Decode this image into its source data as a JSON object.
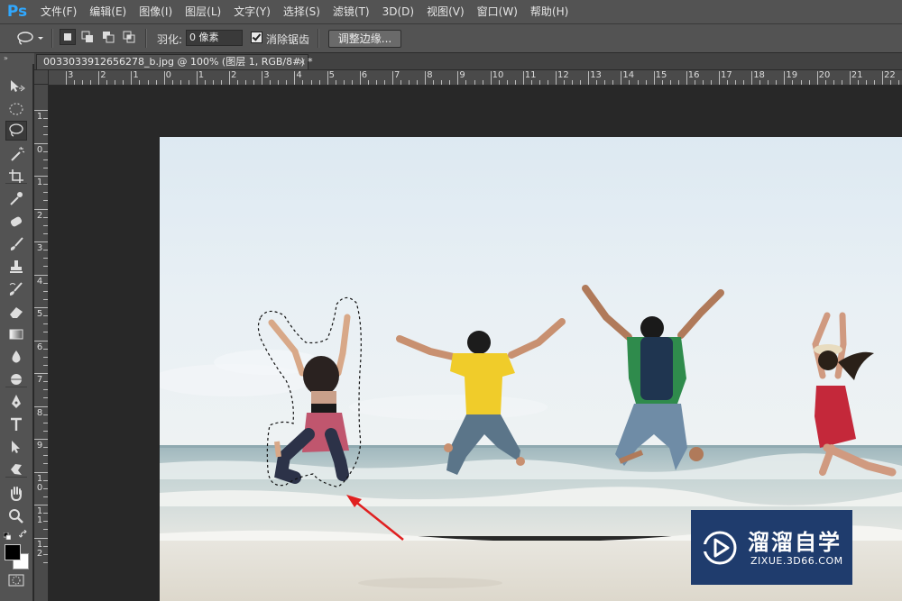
{
  "app": {
    "logo": "Ps"
  },
  "menu": [
    "文件(F)",
    "编辑(E)",
    "图像(I)",
    "图层(L)",
    "文字(Y)",
    "选择(S)",
    "滤镜(T)",
    "3D(D)",
    "视图(V)",
    "窗口(W)",
    "帮助(H)"
  ],
  "options": {
    "feather_label": "羽化:",
    "feather_value": "0 像素",
    "anti_alias_label": "消除锯齿",
    "anti_alias_checked": true,
    "refine_edge_label": "调整边缘..."
  },
  "panel_toggle": "»",
  "document": {
    "tab_title": "0033033912656278_b.jpg @ 100% (图层 1, RGB/8#) *",
    "close_glyph": "×"
  },
  "rulers": {
    "top_labels": [
      "3",
      "2",
      "1",
      "0",
      "1",
      "2",
      "3",
      "4",
      "5",
      "6",
      "7",
      "8",
      "9",
      "10",
      "11",
      "12",
      "13",
      "14",
      "15",
      "16",
      "17",
      "18",
      "19",
      "20",
      "21",
      "22"
    ],
    "left_labels": [
      "1",
      "0",
      "1",
      "2",
      "3",
      "4",
      "5",
      "6",
      "7",
      "8",
      "9",
      "1 0",
      "1 1",
      "1 2"
    ]
  },
  "tools": [
    {
      "name": "move-tool"
    },
    {
      "name": "marquee-tool"
    },
    {
      "name": "lasso-tool",
      "active": true
    },
    {
      "name": "magic-wand-tool"
    },
    {
      "name": "crop-tool"
    },
    {
      "name": "eyedropper-tool"
    },
    {
      "name": "healing-brush-tool"
    },
    {
      "name": "brush-tool"
    },
    {
      "name": "clone-stamp-tool"
    },
    {
      "name": "history-brush-tool"
    },
    {
      "name": "eraser-tool"
    },
    {
      "name": "gradient-tool"
    },
    {
      "name": "blur-tool"
    },
    {
      "name": "dodge-tool"
    },
    {
      "name": "pen-tool"
    },
    {
      "name": "type-tool"
    },
    {
      "name": "path-selection-tool"
    },
    {
      "name": "shape-tool"
    },
    {
      "name": "hand-tool"
    },
    {
      "name": "zoom-tool"
    }
  ],
  "colors": {
    "foreground": "#000000",
    "background": "#ffffff",
    "accent": "#30a8ff",
    "annotation_arrow": "#e02020",
    "watermark_bg": "#1f3c6d"
  },
  "watermark": {
    "title": "溜溜自学",
    "subtitle": "ZIXUE.3D66.COM"
  }
}
